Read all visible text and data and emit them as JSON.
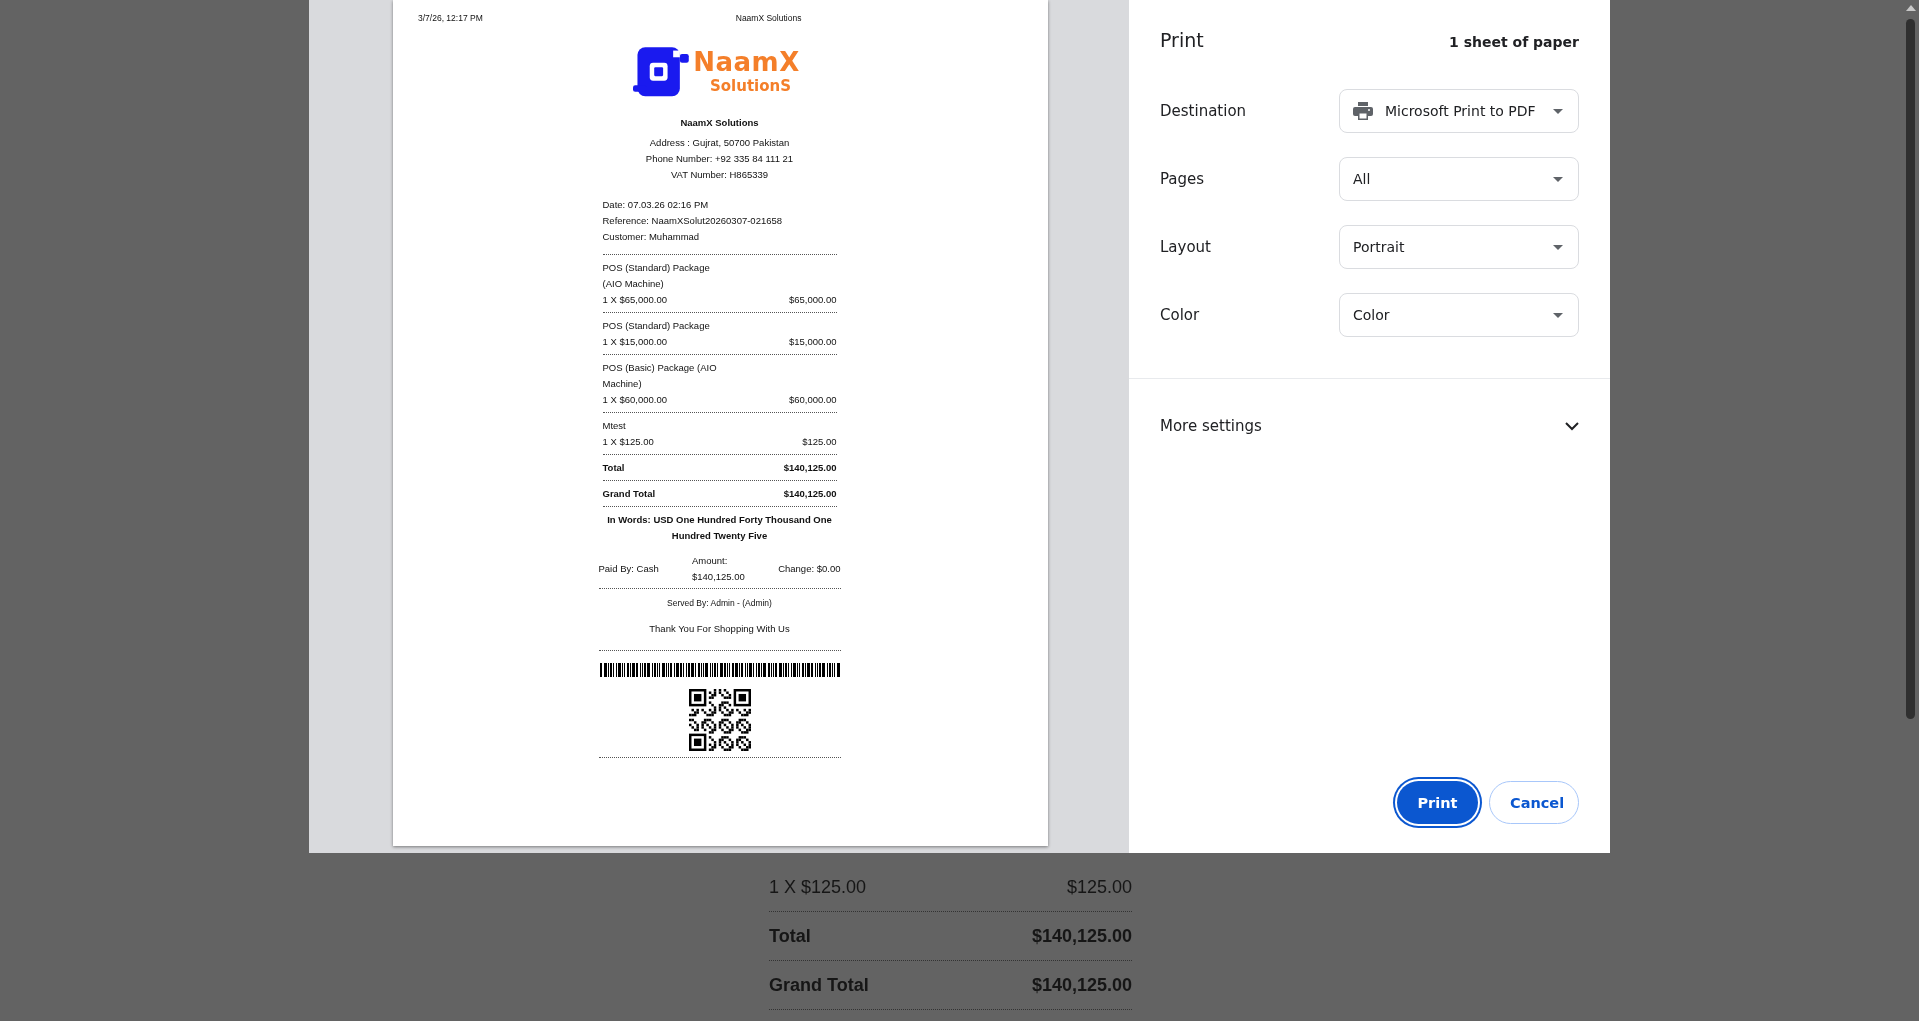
{
  "background_receipt": {
    "item": {
      "qty_price": "1 X $125.00",
      "amount": "$125.00"
    },
    "totals": [
      {
        "label": "Total",
        "value": "$140,125.00"
      },
      {
        "label": "Grand Total",
        "value": "$140,125.00"
      }
    ]
  },
  "preview": {
    "header_date": "3/7/26, 12:17 PM",
    "header_title": "NaamX Solutions",
    "logo": {
      "line1": "NaamX",
      "line2": "SolutionS"
    },
    "company": "NaamX Solutions",
    "info_lines": [
      "Address : Gujrat, 50700 Pakistan",
      "Phone Number: +92 335 84 111 21",
      "VAT Number: H865339"
    ],
    "meta_lines": [
      "Date: 07.03.26 02:16 PM",
      "Reference: NaamXSolut20260307-021658",
      "Customer: Muhammad"
    ],
    "items": [
      {
        "name": "POS (Standard) Package (AIO Machine)",
        "qty_price": "1 X $65,000.00",
        "amount": "$65,000.00"
      },
      {
        "name": "POS (Standard) Package",
        "qty_price": "1 X $15,000.00",
        "amount": "$15,000.00"
      },
      {
        "name": "POS (Basic) Package (AIO Machine)",
        "qty_price": "1 X $60,000.00",
        "amount": "$60,000.00"
      },
      {
        "name": "Mtest",
        "qty_price": "1 X $125.00",
        "amount": "$125.00"
      }
    ],
    "totals": [
      {
        "label": "Total",
        "value": "$140,125.00"
      },
      {
        "label": "Grand Total",
        "value": "$140,125.00"
      }
    ],
    "in_words": "In Words: USD One Hundred Forty Thousand One Hundred Twenty Five",
    "payment": {
      "paid_by": "Paid By: Cash",
      "amount_label": "Amount:",
      "amount_value": "$140,125.00",
      "change": "Change: $0.00"
    },
    "served_by": "Served By: Admin - (Admin)",
    "thank_you": "Thank You For Shopping With Us"
  },
  "print_panel": {
    "title": "Print",
    "sheets": "1 sheet of paper",
    "settings": [
      {
        "label": "Destination",
        "value": "Microsoft Print to PDF",
        "kind": "printer"
      },
      {
        "label": "Pages",
        "value": "All",
        "kind": "plain"
      },
      {
        "label": "Layout",
        "value": "Portrait",
        "kind": "plain"
      },
      {
        "label": "Color",
        "value": "Color",
        "kind": "plain"
      }
    ],
    "more_settings": {
      "label": "More settings",
      "expanded": false
    },
    "buttons": [
      {
        "label": "Print",
        "kind": "primary"
      },
      {
        "label": "Cancel",
        "kind": "secondary"
      }
    ]
  }
}
